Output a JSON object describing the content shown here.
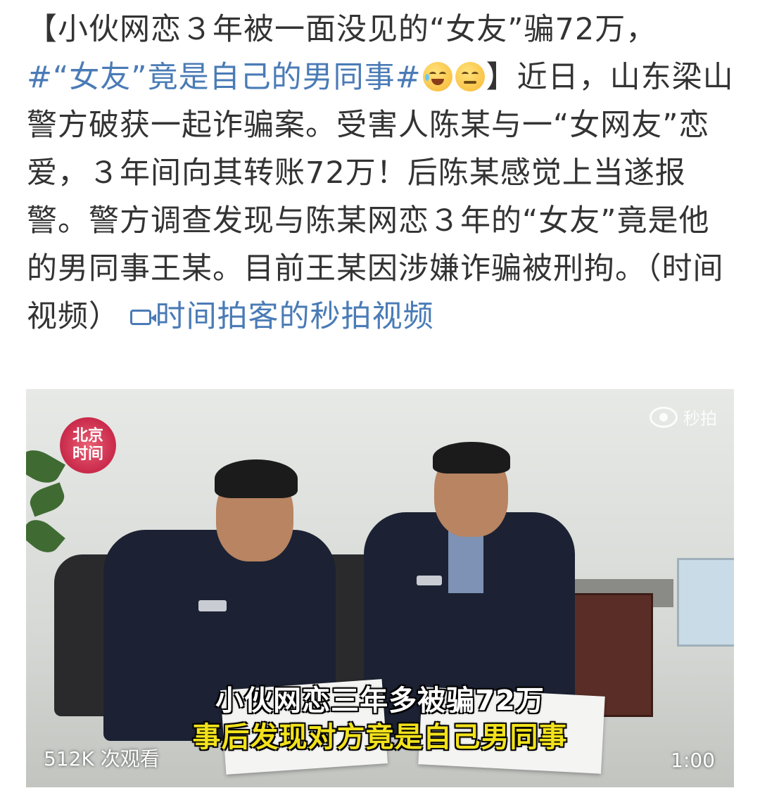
{
  "post": {
    "title_open": "【",
    "title_text": "小伙网恋３年被一面没见的“女友”骗72万，",
    "hashtag": "#“女友”竟是自己的男同事#",
    "title_close": "】",
    "body": "近日，山东梁山警方破获一起诈骗案。受害人陈某与一“女网友”恋爱，３年间向其转账72万！后陈某感觉上当遂报警。警方调查发现与陈某网恋３年的“女友”竟是他的男同事王某。目前王某因涉嫌诈骗被刑拘。（时间视频）",
    "video_link": "时间拍客的秒拍视频",
    "emojis": [
      "laugh-cry-emoji",
      "smirk-emoji"
    ]
  },
  "video": {
    "channel_logo_line1": "北京",
    "channel_logo_line2": "时间",
    "watermark": "秒拍",
    "caption_line1": "小伙网恋三年多被骗72万",
    "caption_line2": "事后发现对方竟是自己男同事",
    "views": "512K 次观看",
    "duration": "1:00"
  }
}
